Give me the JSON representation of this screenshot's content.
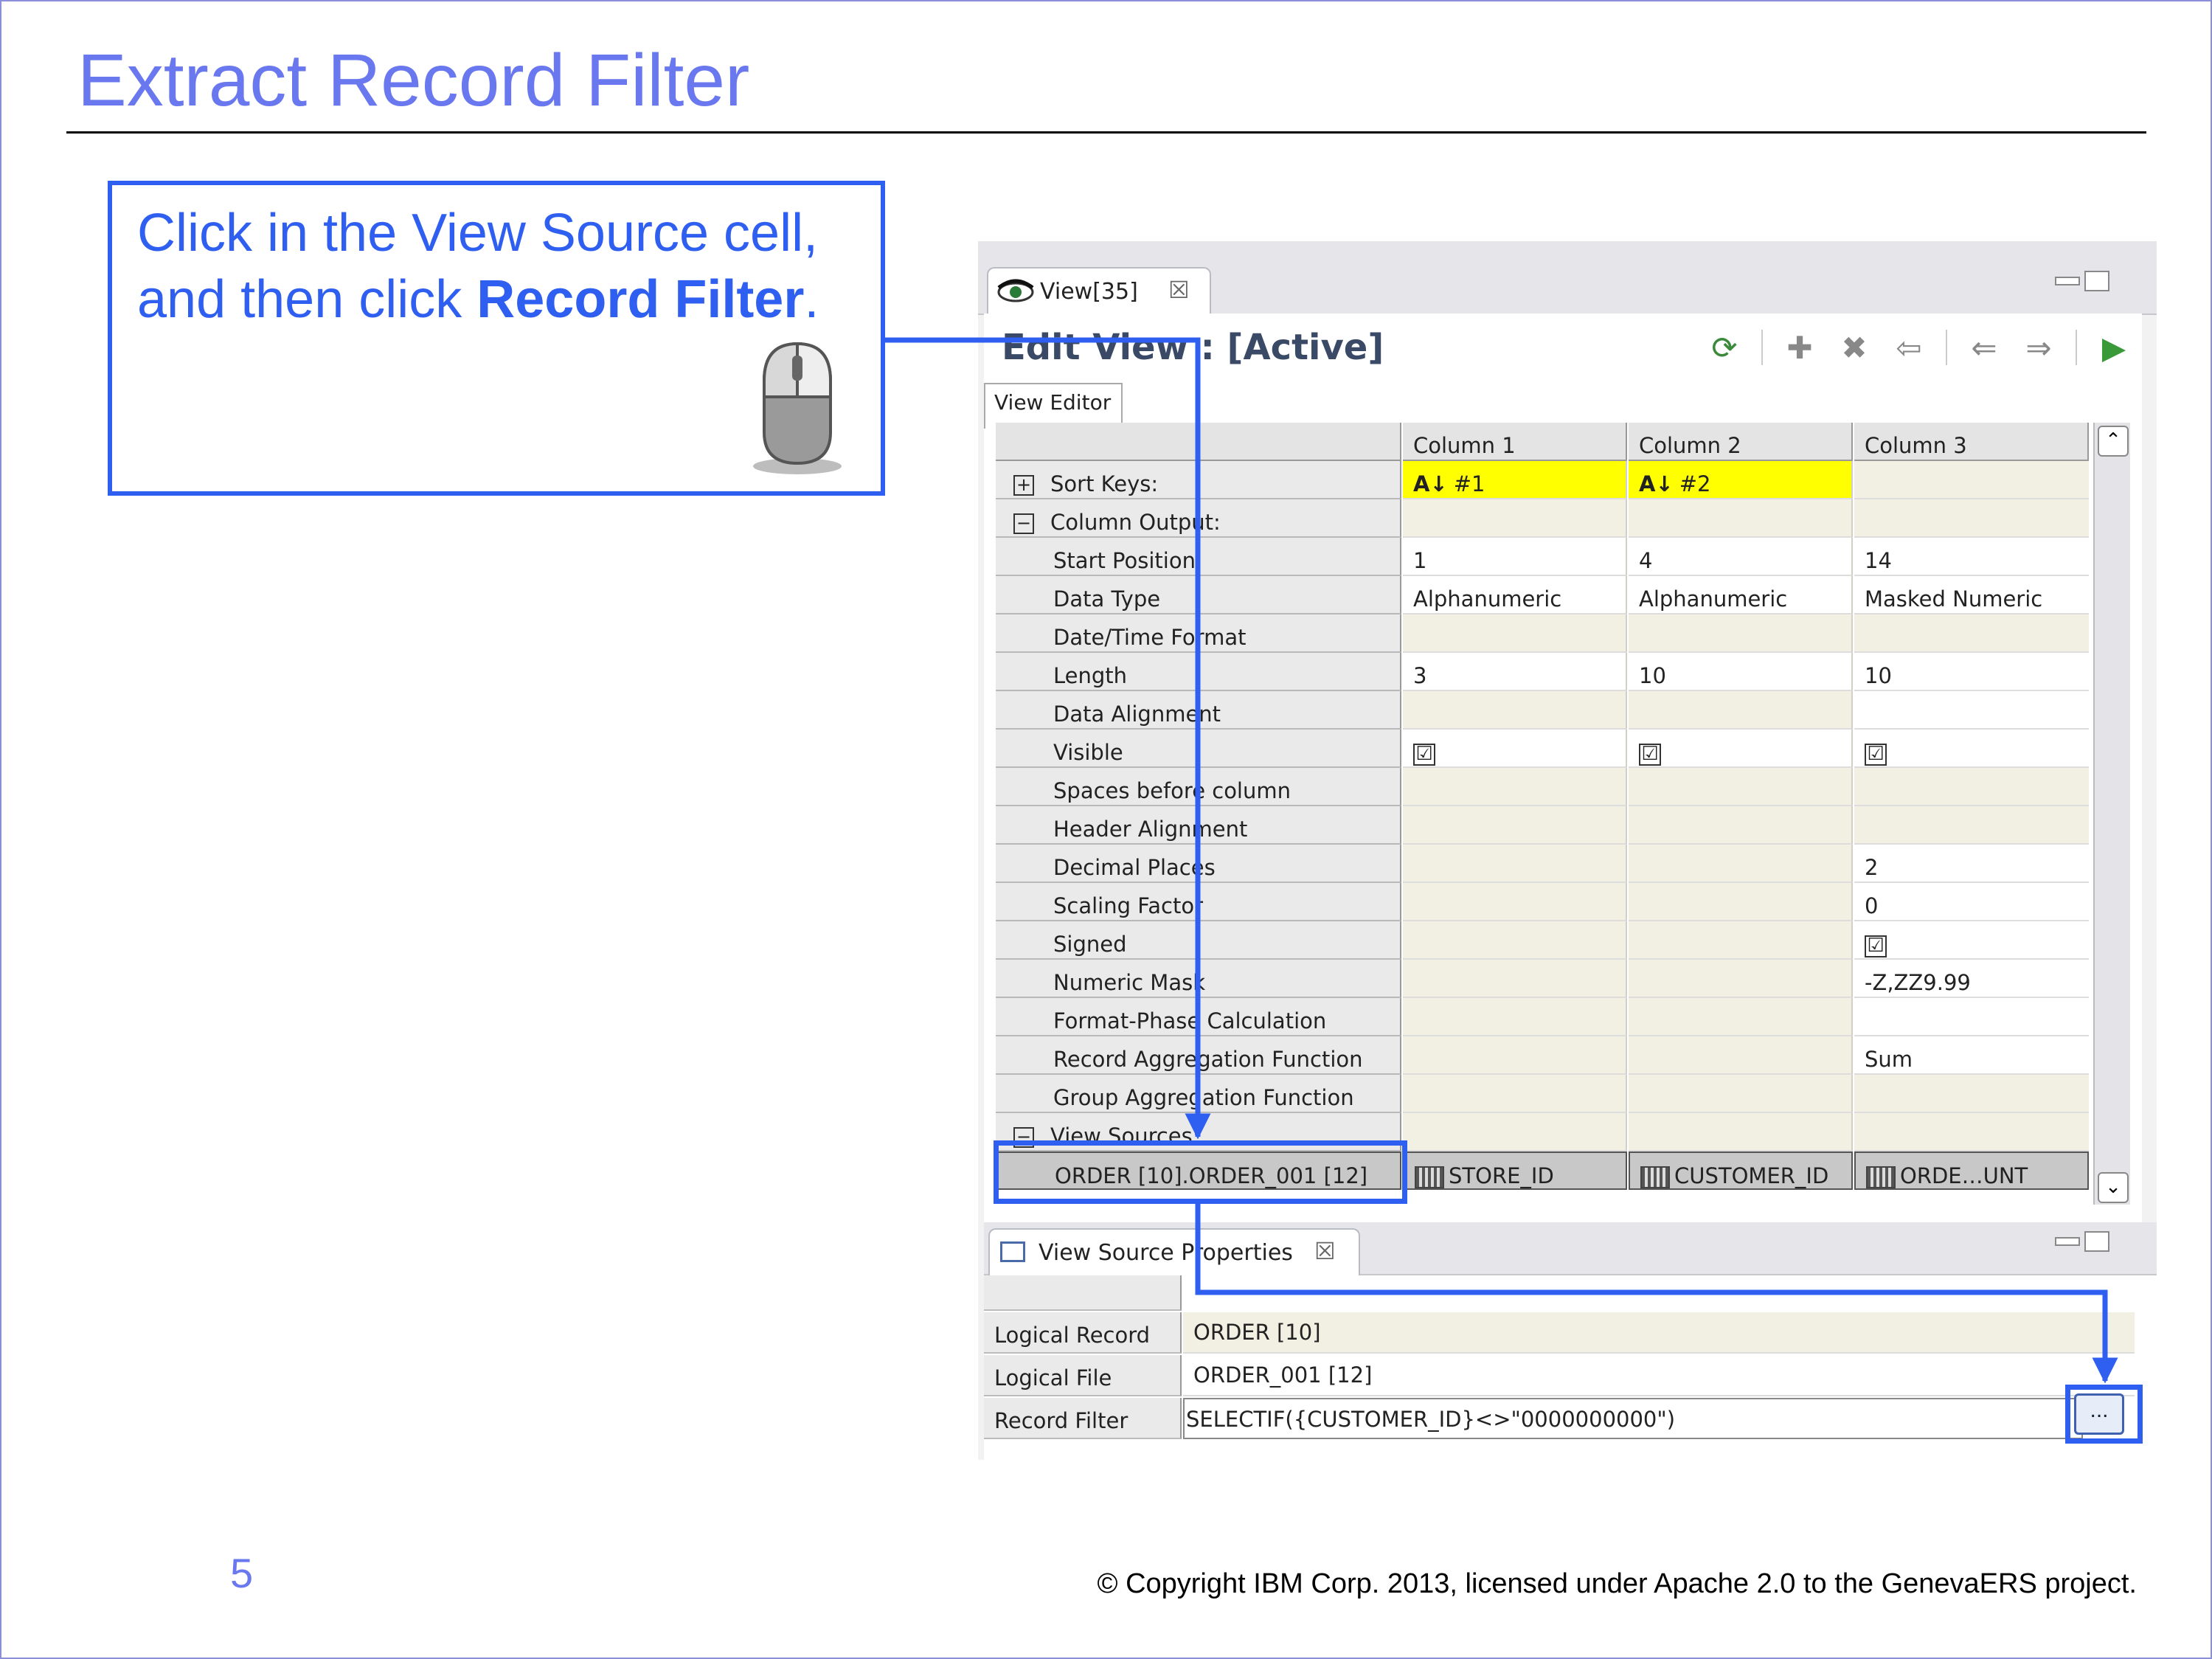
{
  "slide": {
    "title": "Extract Record Filter",
    "page_number": "5",
    "copyright": "© Copyright IBM Corp. 2013, licensed under Apache 2.0 to the GenevaERS project."
  },
  "callout": {
    "line1": "Click in the View Source cell,",
    "line2_prefix": "and then click ",
    "line2_bold": "Record Filter",
    "line2_suffix": ".",
    "icon": "mouse-icon"
  },
  "editor": {
    "tab_label": "View[35]",
    "title": "Edit View : [Active]",
    "subtab": "View Editor",
    "columns": [
      "Column 1",
      "Column 2",
      "Column 3"
    ],
    "sort_keys_label": "Sort Keys:",
    "sort_keys": [
      "#1",
      "#2",
      ""
    ],
    "column_output_label": "Column Output:",
    "rows": [
      {
        "label": "Start Position",
        "values": [
          "1",
          "4",
          "14"
        ]
      },
      {
        "label": "Data Type",
        "values": [
          "Alphanumeric",
          "Alphanumeric",
          "Masked Numeric"
        ]
      },
      {
        "label": "Date/Time Format",
        "values": [
          "",
          "",
          ""
        ]
      },
      {
        "label": "Length",
        "values": [
          "3",
          "10",
          "10"
        ]
      },
      {
        "label": "Data Alignment",
        "values": [
          "",
          "",
          ""
        ]
      },
      {
        "label": "Visible",
        "values": [
          "☑",
          "☑",
          "☑"
        ]
      },
      {
        "label": "Spaces before column",
        "values": [
          "",
          "",
          ""
        ]
      },
      {
        "label": "Header Alignment",
        "values": [
          "",
          "",
          ""
        ]
      },
      {
        "label": "Decimal Places",
        "values": [
          "",
          "",
          "2"
        ]
      },
      {
        "label": "Scaling Factor",
        "values": [
          "",
          "",
          "0"
        ]
      },
      {
        "label": "Signed",
        "values": [
          "",
          "",
          "☑"
        ]
      },
      {
        "label": "Numeric Mask",
        "values": [
          "",
          "",
          "-Z,ZZ9.99"
        ]
      },
      {
        "label": "Format-Phase Calculation",
        "values": [
          "",
          "",
          ""
        ]
      },
      {
        "label": "Record Aggregation Function",
        "values": [
          "",
          "",
          "Sum"
        ]
      },
      {
        "label": "Group Aggregation Function",
        "values": [
          "",
          "",
          ""
        ]
      }
    ],
    "view_sources_label": "View Sources:",
    "view_source": {
      "label": "ORDER [10].ORDER_001 [12]",
      "values": [
        "STORE_ID",
        "CUSTOMER_ID",
        "ORDE…UNT"
      ]
    }
  },
  "props": {
    "tab_label": "View Source Properties",
    "rows": [
      {
        "label": "Logical Record",
        "value": "ORDER [10]"
      },
      {
        "label": "Logical File",
        "value": "ORDER_001 [12]"
      },
      {
        "label": "Record Filter",
        "value": "SELECTIF({CUSTOMER_ID}<>\"0000000000\")"
      }
    ],
    "pick_button": "..."
  },
  "colors": {
    "accent": "#2f5ff0",
    "title": "#6a78f0",
    "sort_highlight": "#ffff00",
    "beige_cell": "#f2f0e2"
  }
}
